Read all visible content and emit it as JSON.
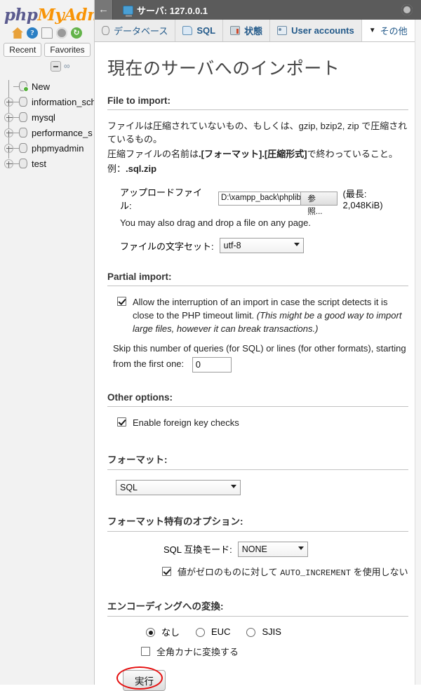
{
  "sidebar": {
    "logo_part1": "php",
    "logo_part2": "MyAdm",
    "icons": [
      {
        "name": "home-icon",
        "glyph": ""
      },
      {
        "name": "help-icon",
        "glyph": "?"
      },
      {
        "name": "documentation-icon",
        "glyph": ""
      },
      {
        "name": "settings-icon",
        "glyph": ""
      },
      {
        "name": "reload-icon",
        "glyph": "↻"
      }
    ],
    "recent_label": "Recent",
    "favorites_label": "Favorites",
    "collapse_icon": "minus-icon",
    "chain_icon": "∞",
    "tree": [
      {
        "label": "New",
        "expandable": false
      },
      {
        "label": "information_sch",
        "expandable": true
      },
      {
        "label": "mysql",
        "expandable": true
      },
      {
        "label": "performance_s",
        "expandable": true
      },
      {
        "label": "phpmyadmin",
        "expandable": true
      },
      {
        "label": "test",
        "expandable": true
      }
    ]
  },
  "topbar": {
    "back_label": "←",
    "server_label": "サーバ: 127.0.0.1",
    "gear_icon": "gear-icon"
  },
  "tabs": [
    {
      "label": "データベース",
      "icon": "database-icon",
      "active": false,
      "bold": false
    },
    {
      "label": "SQL",
      "icon": "sql-icon",
      "active": false,
      "bold": true
    },
    {
      "label": "状態",
      "icon": "status-icon",
      "active": false,
      "bold": true
    },
    {
      "label": "User accounts",
      "icon": "users-icon",
      "active": false,
      "bold": true
    },
    {
      "label": "その他",
      "icon": "chevron-down-icon",
      "active": true,
      "bold": false
    }
  ],
  "page": {
    "title": "現在のサーバへのインポート"
  },
  "file_section": {
    "heading": "File to import:",
    "desc_line1": "ファイルは圧縮されていないもの、もしくは、gzip, bzip2, zip で圧縮されているもの。",
    "desc_line2_pre": "圧縮ファイルの名前は",
    "desc_line2_bold": ".[フォーマット].[圧縮形式]",
    "desc_line2_post": "で終わっていること。",
    "desc_line3_pre": "例：",
    "desc_line3_bold": ".sql.zip",
    "upload_label": "アップロードファイル:",
    "upload_value": "D:\\xampp_back\\phplibs.s",
    "browse_button": "参照...",
    "max_size": "(最長: 2,048KiB)",
    "dragdrop_note": "You may also drag and drop a file on any page.",
    "charset_label": "ファイルの文字セット:",
    "charset_value": "utf-8",
    "charset_options": [
      "utf-8"
    ]
  },
  "partial_section": {
    "heading": "Partial import:",
    "allow_checkbox_checked": true,
    "allow_text_normal": "Allow the interruption of an import in case the script detects it is close to the PHP timeout limit. ",
    "allow_text_italic": "(This might be a good way to import large files, however it can break transactions.)",
    "skip_text": "Skip this number of queries (for SQL) or lines (for other formats), starting from the first one:",
    "skip_value": "0"
  },
  "other_section": {
    "heading": "Other options:",
    "fk_checkbox_checked": true,
    "fk_label": "Enable foreign key checks"
  },
  "format_section": {
    "heading": "フォーマット:",
    "value": "SQL",
    "options": [
      "SQL"
    ]
  },
  "format_options_section": {
    "heading": "フォーマット特有のオプション:",
    "compat_label": "SQL 互換モード:",
    "compat_value": "NONE",
    "compat_options": [
      "NONE"
    ],
    "auto_increment_checked": true,
    "auto_increment_label_pre": "値がゼロのものに対して ",
    "auto_increment_label_mono": "AUTO_INCREMENT",
    "auto_increment_label_post": " を使用しない"
  },
  "encoding_section": {
    "heading": "エンコーディングへの変換:",
    "radios": [
      {
        "label": "なし",
        "selected": true
      },
      {
        "label": "EUC",
        "selected": false
      },
      {
        "label": "SJIS",
        "selected": false
      }
    ],
    "zenkaku_checked": false,
    "zenkaku_label": "全角カナに変換する"
  },
  "footer": {
    "execute_label": "実行",
    "annotation_color": "#e51010"
  }
}
